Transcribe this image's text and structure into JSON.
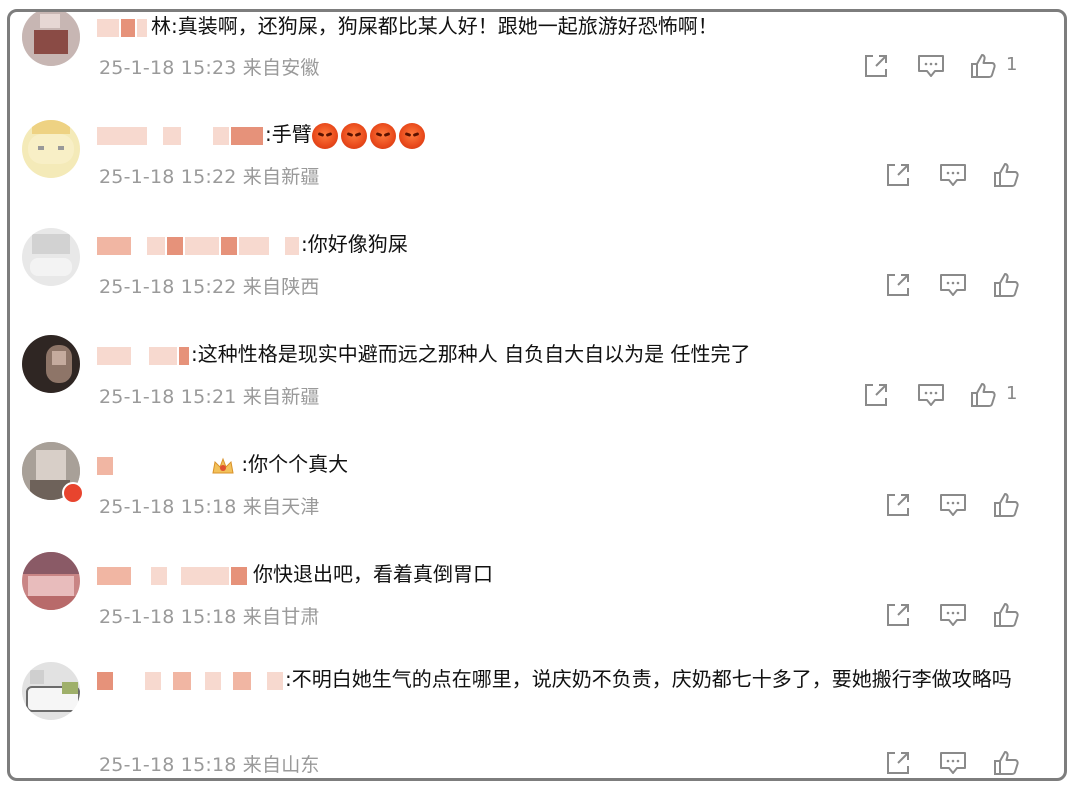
{
  "comments": [
    {
      "id": "c1",
      "text": "林:真装啊，还狗屎，狗屎都比某人好！跟她一起旅游好恐怖啊！",
      "meta": "25-1-18 15:23 来自安徽",
      "likes": "1",
      "avatar_colors": [
        "#b9a9a6",
        "#8a4b45",
        "#d9c6c4"
      ]
    },
    {
      "id": "c2",
      "text": ":手臂",
      "emoji_count": 4,
      "meta": "25-1-18 15:22 来自新疆",
      "likes": "",
      "avatar_colors": [
        "#f6e9b2",
        "#f1d77a",
        "#e9c46a"
      ]
    },
    {
      "id": "c3",
      "text": ":你好像狗屎",
      "meta": "25-1-18 15:22 来自陕西",
      "likes": "",
      "avatar_colors": [
        "#e5e5e5",
        "#d0d0d0",
        "#f0f0f0"
      ]
    },
    {
      "id": "c4",
      "text": ":这种性格是现实中避而远之那种人 自负自大自以为是 任性完了",
      "meta": "25-1-18 15:21 来自新疆",
      "likes": "1",
      "avatar_colors": [
        "#3b2f2c",
        "#9a7f72",
        "#c8b0a2"
      ]
    },
    {
      "id": "c5",
      "text": ":你个个真大",
      "meta": "25-1-18 15:18 来自天津",
      "likes": "",
      "avatar_colors": [
        "#a59c95",
        "#d8cfc8",
        "#6e625a"
      ]
    },
    {
      "id": "c6",
      "text": "你快退出吧，看着真倒胃口",
      "meta": "25-1-18 15:18 来自甘肃",
      "likes": "",
      "avatar_colors": [
        "#c97b7b",
        "#8a4f5a",
        "#e6b7b7"
      ]
    },
    {
      "id": "c7",
      "text": ":不明白她生气的点在哪里，说庆奶不负责，庆奶都七十多了，要她搬行李做攻略吗",
      "meta": "25-1-18 15:18 来自山东",
      "likes": "",
      "avatar_colors": [
        "#d7d7d7",
        "#9fb06a",
        "#6b6b6b"
      ]
    }
  ],
  "colors": {
    "blur_dark": "#e6927a",
    "blur_light": "#f7d9cf",
    "meta_text": "#9a9a9a",
    "icon": "#8a8a8a"
  },
  "icons": [
    "share-icon",
    "comment-icon",
    "like-icon",
    "emoji-angry-icon",
    "crown-icon"
  ]
}
